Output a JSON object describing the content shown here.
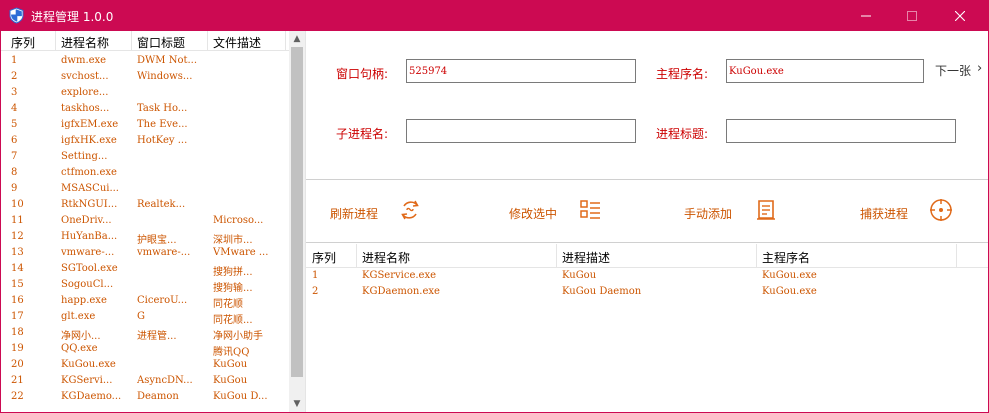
{
  "window": {
    "title": "进程管理 1.0.0",
    "accent": "#cc0a52"
  },
  "left_list": {
    "headers": [
      "序列",
      "进程名称",
      "窗口标题",
      "文件描述"
    ],
    "rows": [
      [
        "1",
        "dwm.exe",
        "DWM Not...",
        ""
      ],
      [
        "2",
        "svchost...",
        "Windows...",
        ""
      ],
      [
        "3",
        "explore...",
        "",
        ""
      ],
      [
        "4",
        "taskhos...",
        "Task Ho...",
        ""
      ],
      [
        "5",
        "igfxEM.exe",
        "The Eve...",
        ""
      ],
      [
        "6",
        "igfxHK.exe",
        "HotKey ...",
        ""
      ],
      [
        "7",
        "Setting...",
        "",
        ""
      ],
      [
        "8",
        "ctfmon.exe",
        "",
        ""
      ],
      [
        "9",
        "MSASCui...",
        "",
        ""
      ],
      [
        "10",
        "RtkNGUI...",
        "Realtek...",
        ""
      ],
      [
        "11",
        "OneDriv...",
        "",
        "Microso..."
      ],
      [
        "12",
        "HuYanBa...",
        "护眼宝...",
        "深圳市..."
      ],
      [
        "13",
        "vmware-...",
        "vmware-...",
        "VMware ..."
      ],
      [
        "14",
        "SGTool.exe",
        "",
        "搜狗拼..."
      ],
      [
        "15",
        "SogouCl...",
        "",
        "搜狗输..."
      ],
      [
        "16",
        "happ.exe",
        "CiceroU...",
        "同花顺"
      ],
      [
        "17",
        "glt.exe",
        "G",
        "同花顺..."
      ],
      [
        "18",
        "净网小...",
        "进程管...",
        "净网小助手"
      ],
      [
        "19",
        "QQ.exe",
        "",
        "腾讯QQ"
      ],
      [
        "20",
        "KuGou.exe",
        "",
        "KuGou"
      ],
      [
        "21",
        "KGServi...",
        "AsyncDN...",
        "KuGou"
      ],
      [
        "22",
        "KGDaemo...",
        "Deamon",
        "KuGou D..."
      ]
    ]
  },
  "form": {
    "hwnd_label": "窗口句柄:",
    "hwnd_value": "525974",
    "main_proc_label": "主程序名:",
    "main_proc_value": "KuGou.exe",
    "child_proc_label": "子进程名:",
    "child_proc_value": "",
    "proc_title_label": "进程标题:",
    "proc_title_value": "",
    "next_label": "下一张"
  },
  "actions": {
    "refresh": "刷新进程",
    "edit": "修改选中",
    "manual_add": "手动添加",
    "capture": "捕获进程"
  },
  "right_table": {
    "headers": [
      "序列",
      "进程名称",
      "进程描述",
      "主程序名"
    ],
    "rows": [
      [
        "1",
        "KGService.exe",
        "KuGou",
        "KuGou.exe"
      ],
      [
        "2",
        "KGDaemon.exe",
        "KuGou Daemon",
        "KuGou.exe"
      ]
    ]
  }
}
